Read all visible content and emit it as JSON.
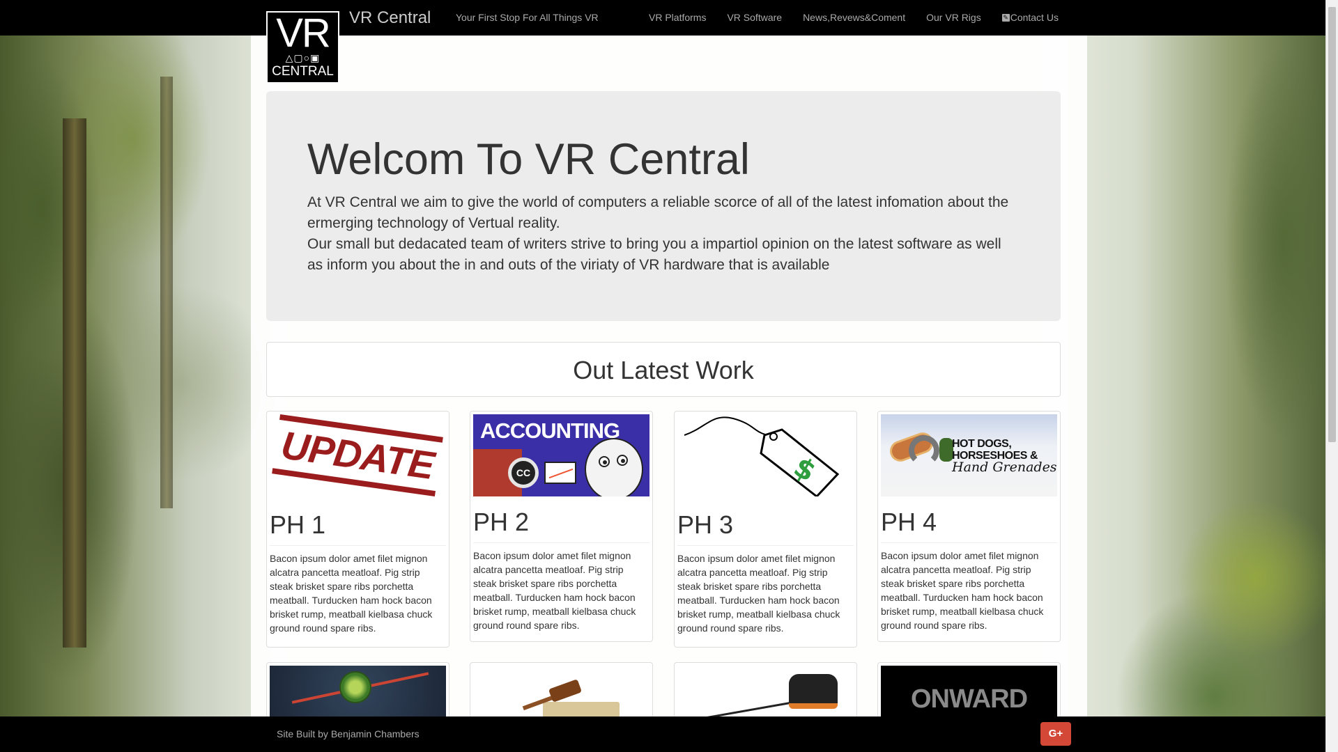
{
  "brand": {
    "logo_top": "VR",
    "logo_bottom": "CENTRAL",
    "name": "VR Central",
    "tagline": "Your First Stop For All Things VR"
  },
  "nav": [
    {
      "label": "VR Platforms",
      "icon": ""
    },
    {
      "label": "VR Software",
      "icon": ""
    },
    {
      "label": "News,Revews&Coment",
      "icon": ""
    },
    {
      "label": "Our VR Rigs",
      "icon": ""
    },
    {
      "label": "Contact Us",
      "icon": "edit-icon"
    }
  ],
  "jumbotron": {
    "title": "Welcom To VR Central",
    "paragraph1": "At VR Central we aim to give the world of computers a reliable scorce of all of the latest infomation about the ermerging technology of Vertual reality.",
    "paragraph2": "Our small but dedacated team of writers strive to bring you a impartiol opinion on the latest software as well as inform you about the in and outs of the viriaty of VR hardware that is available"
  },
  "section": {
    "title": "Out Latest Work"
  },
  "cards": [
    {
      "title": "PH 1",
      "image": "update-stamp",
      "image_text": "UPDATE",
      "text": "Bacon ipsum dolor amet filet mignon alcatra pancetta meatloaf. Pig strip steak brisket spare ribs porchetta meatball. Turducken ham hock bacon brisket rump, meatball kielbasa chuck ground round spare ribs."
    },
    {
      "title": "PH 2",
      "image": "accounting-cartoon",
      "image_text": "ACCOUNTING",
      "text": "Bacon ipsum dolor amet filet mignon alcatra pancetta meatloaf. Pig strip steak brisket spare ribs porchetta meatball. Turducken ham hock bacon brisket rump, meatball kielbasa chuck ground round spare ribs."
    },
    {
      "title": "PH 3",
      "image": "price-tag",
      "image_text": "",
      "text": "Bacon ipsum dolor amet filet mignon alcatra pancetta meatloaf. Pig strip steak brisket spare ribs porchetta meatball. Turducken ham hock bacon brisket rump, meatball kielbasa chuck ground round spare ribs."
    },
    {
      "title": "PH 4",
      "image": "hot-dogs-game-art",
      "image_text_1": "HOT DOGS,",
      "image_text_2": "HORSESHOES &",
      "image_text_3": "Hand Grenades",
      "text": "Bacon ipsum dolor amet filet mignon alcatra pancetta meatloaf. Pig strip steak brisket spare ribs porchetta meatball. Turducken ham hock bacon brisket rump, meatball kielbasa chuck ground round spare ribs."
    }
  ],
  "cards_row2": [
    {
      "image": "fruit-ninja-art"
    },
    {
      "image": "gavel-money"
    },
    {
      "image": "vr-headset"
    },
    {
      "image": "onward-logo",
      "image_text": "ONWARD"
    }
  ],
  "footer": {
    "credit": "Site Built by Benjamin Chambers",
    "social_label": "G+"
  },
  "colors": {
    "navbar": "#000000",
    "jumbotron": "#ececec",
    "google_plus": "#d34836",
    "update_red": "#9b1c1c",
    "accounting_purple": "#3b2fa8"
  }
}
